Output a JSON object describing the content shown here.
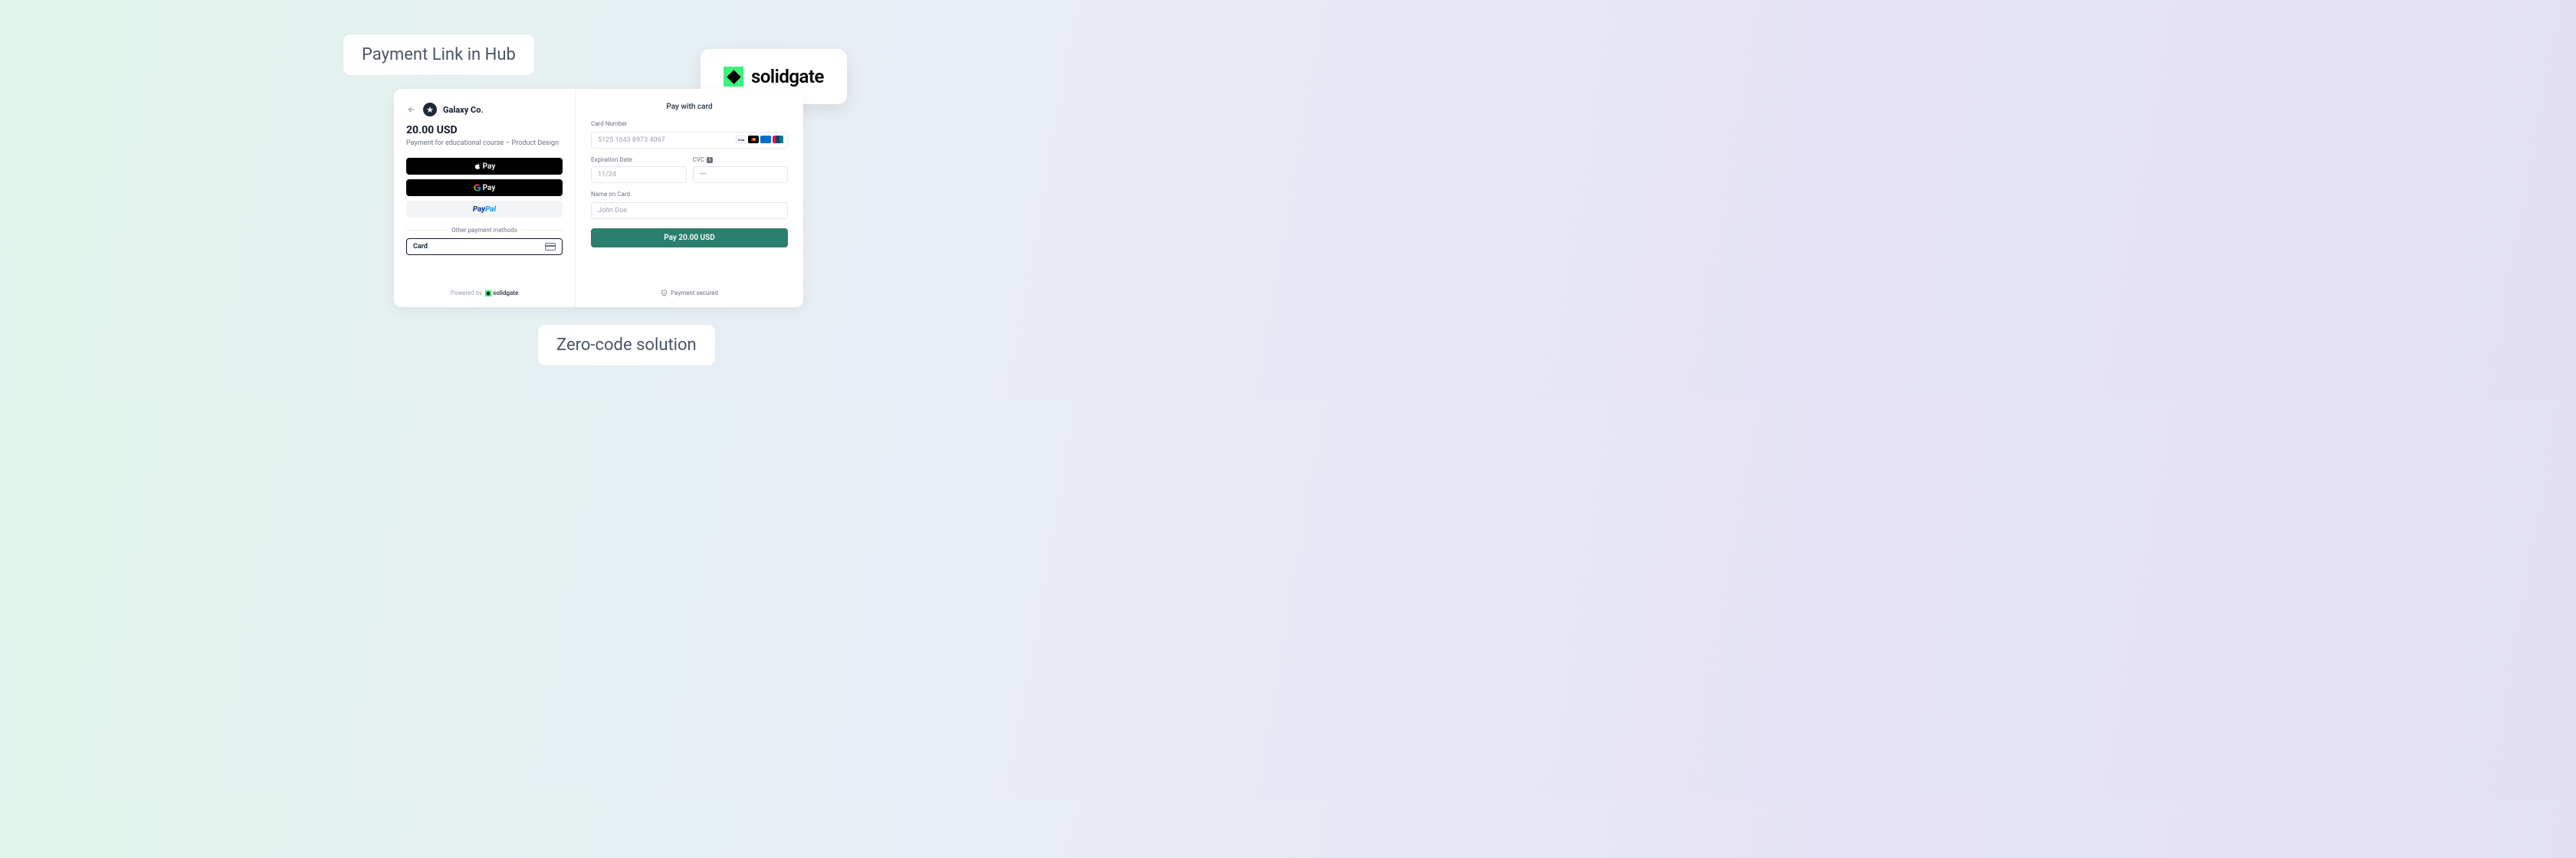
{
  "labels": {
    "top": "Payment Link in Hub",
    "bottom": "Zero-code solution"
  },
  "brand": {
    "name": "solidgate"
  },
  "checkout": {
    "merchant_name": "Galaxy Co.",
    "amount": "20.00 USD",
    "description": "Payment for educational course – Product Design",
    "apple_pay_label": "Pay",
    "google_pay_label": "Pay",
    "divider_text": "Other payment methods",
    "card_option_label": "Card",
    "powered_by": "Powered by",
    "powered_brand": "solidgate"
  },
  "form": {
    "title": "Pay with card",
    "card_number_label": "Card Number",
    "card_number_placeholder": "5125 1643 8973 4067",
    "expiration_label": "Expiration Date",
    "expiration_placeholder": "11/24",
    "cvc_label": "CVC",
    "cvc_placeholder": "•••",
    "name_label": "Name on Card",
    "name_placeholder": "John Doe",
    "submit_label": "Pay 20.00 USD",
    "secured_text": "Payment secured"
  }
}
